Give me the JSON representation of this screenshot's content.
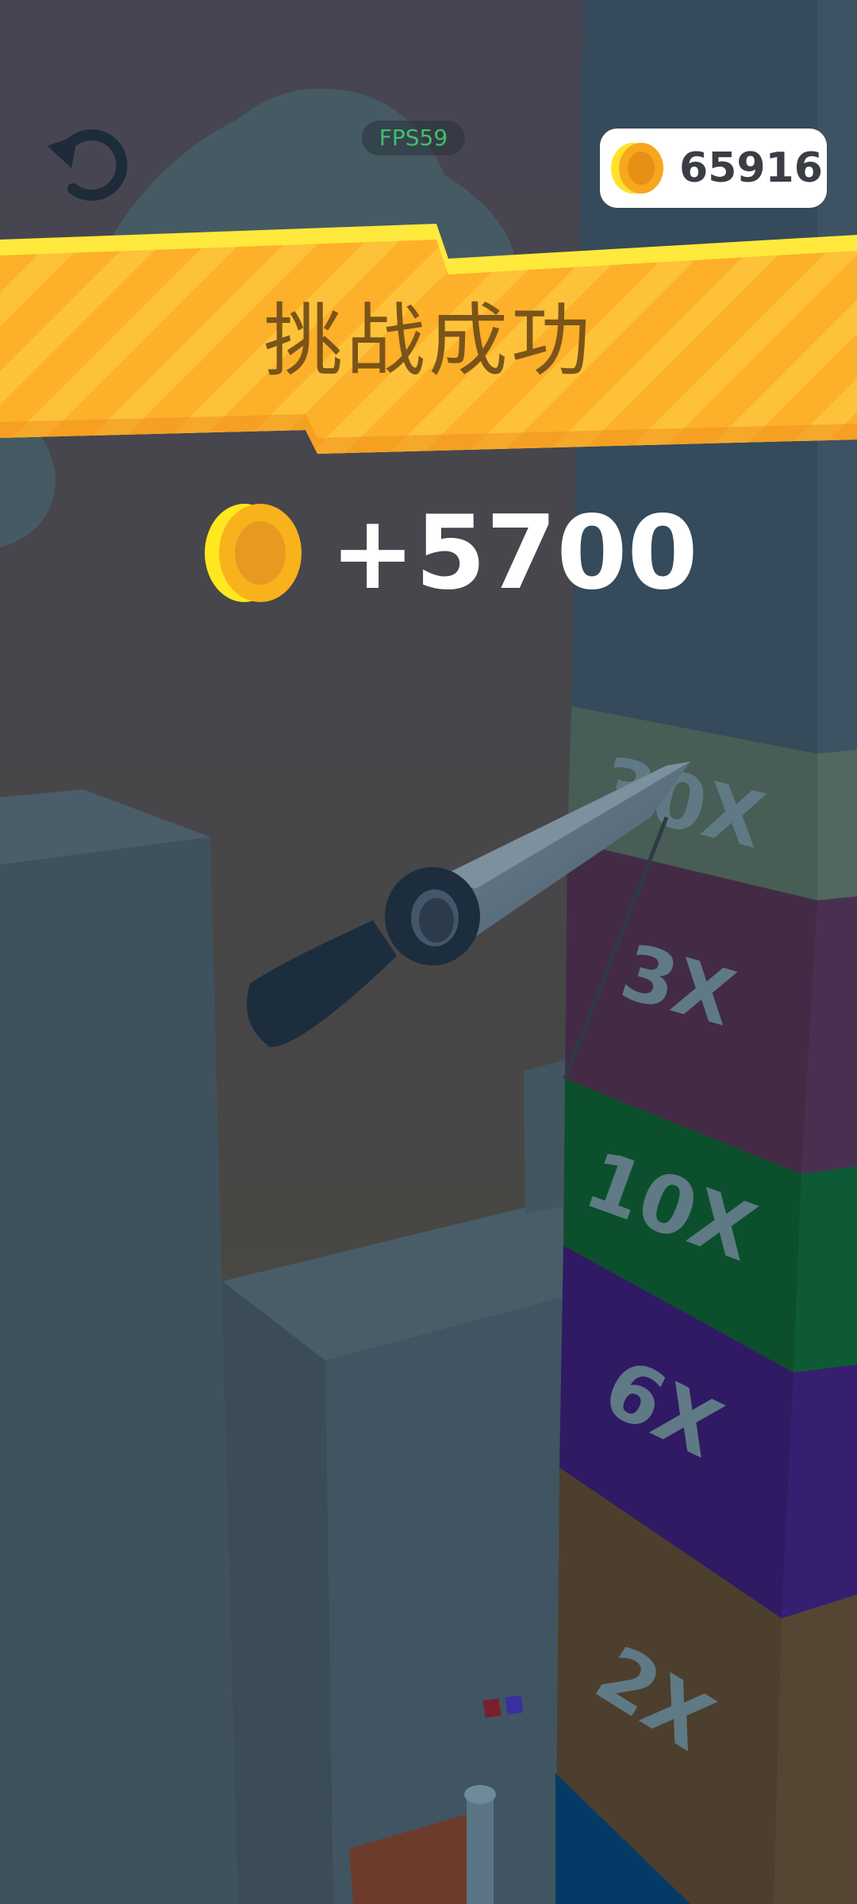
{
  "hud": {
    "fps_label": "FPS59",
    "coin_balance": "65916"
  },
  "banner": {
    "title": "挑战成功"
  },
  "reward": {
    "amount": "+5700"
  },
  "tower": {
    "blocks": [
      {
        "label": "30X",
        "color": "#475d55"
      },
      {
        "label": "3X",
        "color": "#432b45"
      },
      {
        "label": "10X",
        "color": "#0c4f2d"
      },
      {
        "label": "6X",
        "color": "#2f1a63"
      },
      {
        "label": "2X",
        "color": "#4d3f2d"
      }
    ]
  },
  "colors": {
    "banner_yellow": "#fdb429",
    "coin_gold": "#f7c31a",
    "fps_green": "#3fbf6a"
  },
  "icons": {
    "restart": "restart-icon",
    "coin": "coin-icon",
    "knife": "knife-icon"
  }
}
